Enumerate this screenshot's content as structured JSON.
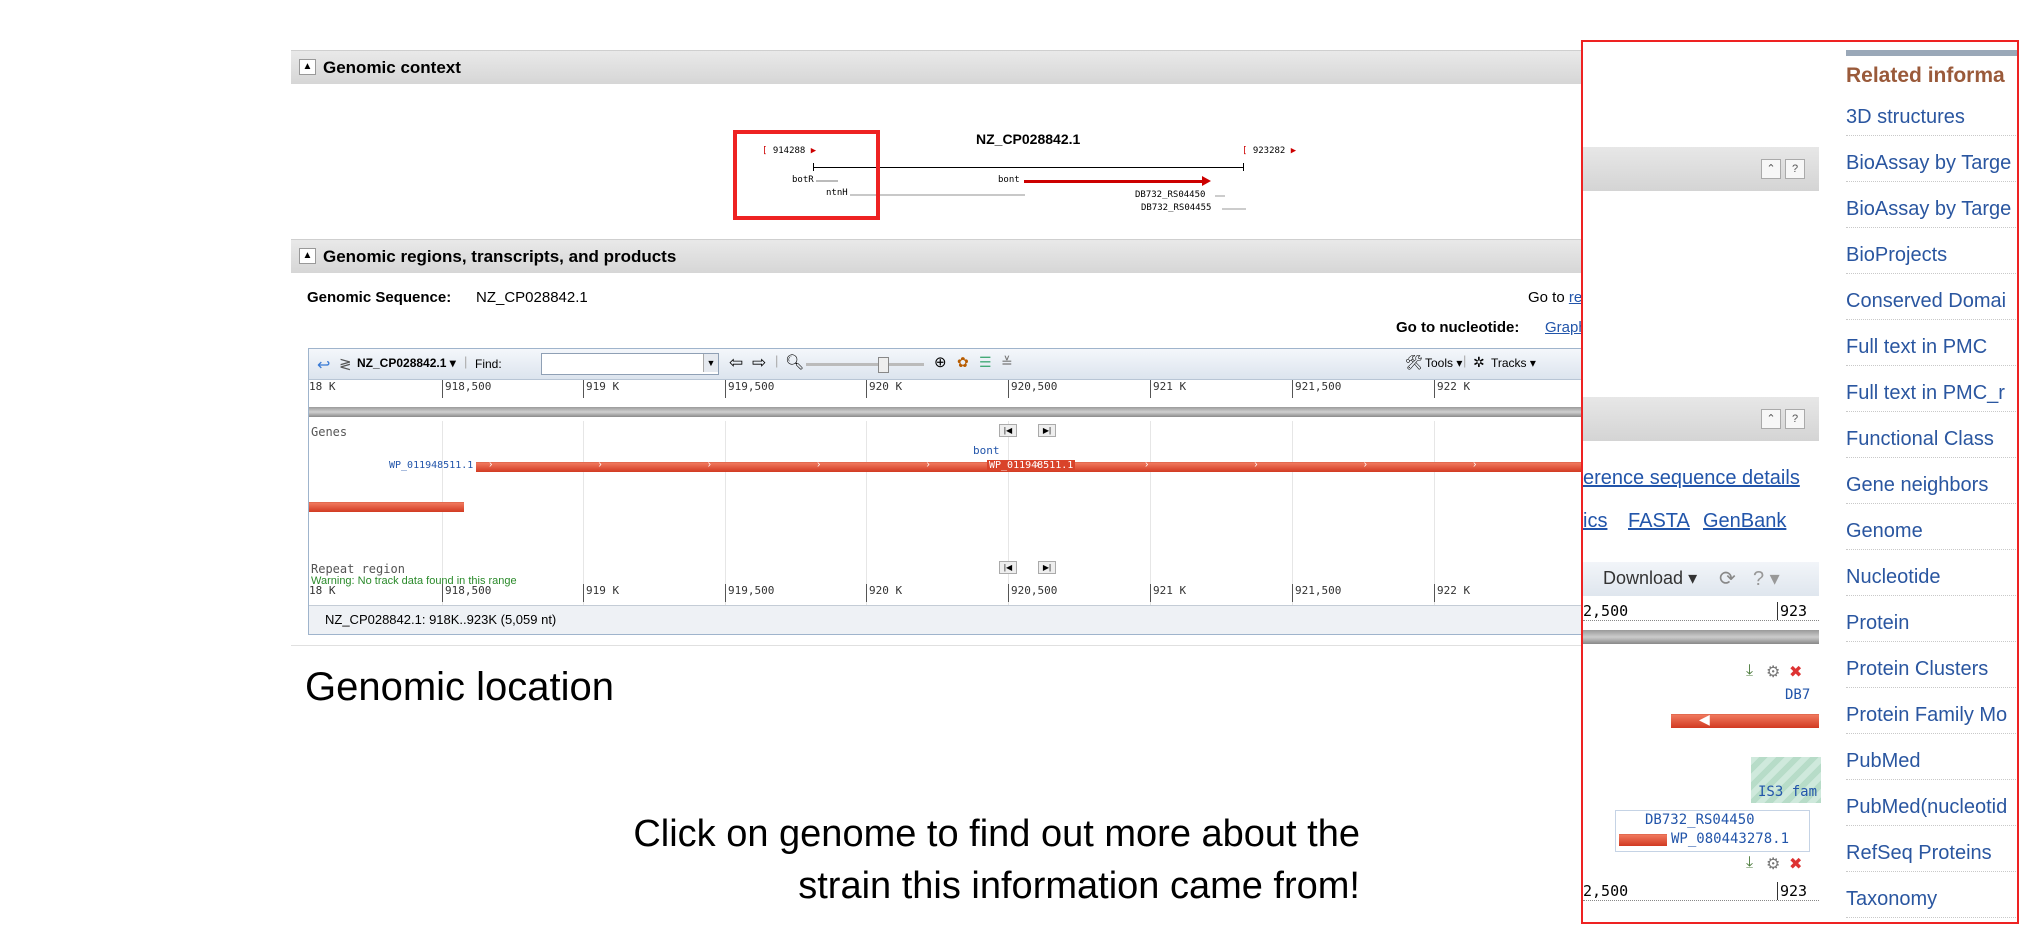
{
  "sections": {
    "genomic_context": "Genomic context",
    "genomic_regions": "Genomic regions, transcripts, and products"
  },
  "context": {
    "accession": "NZ_CP028842.1",
    "start": "914288",
    "end": "923282",
    "genes": [
      "botR",
      "ntnH",
      "bont",
      "DB732_RS04450",
      "DB732_RS04455"
    ]
  },
  "sequence": {
    "label": "Genomic Sequence:",
    "value": "NZ_CP028842.1",
    "goto_ref_prefix": "Go to ",
    "goto_ref_link": "re",
    "goto_nuc_label": "Go to nucleotide:",
    "goto_nuc_link": "Graph"
  },
  "viewer": {
    "accession": "NZ_CP028842.1",
    "find_label": "Find:",
    "tools": "Tools",
    "tracks": "Tracks",
    "ruler": [
      "18 K",
      "918,500",
      "919 K",
      "919,500",
      "920 K",
      "920,500",
      "921 K",
      "921,500",
      "922 K"
    ],
    "genes_track": "Genes",
    "gene_name": "bont",
    "protein_left": "WP_011948511.1",
    "protein_mid": "WP_011948511.1",
    "repeat_track": "Repeat region",
    "warning": "Warning: No track data found in this range",
    "status": "NZ_CP028842.1: 918K..923K (5,059 nt)"
  },
  "genomic_location": "Genomic location",
  "caption": {
    "line1": "Click on genome to find out more about the",
    "line2": "strain this information came from!"
  },
  "overlay": {
    "related_title": "Related informa",
    "related_items": [
      "3D structures",
      "BioAssay by Targe",
      "BioAssay by Targe",
      "BioProjects",
      "Conserved Domai",
      "Full text in PMC",
      "Full text in PMC_r",
      "Functional Class",
      "Gene neighbors",
      "Genome",
      "Nucleotide",
      "Protein",
      "Protein Clusters",
      "Protein Family Mo",
      "PubMed",
      "PubMed(nucleotid",
      "RefSeq Proteins",
      "Taxonomy"
    ],
    "ref_seq_details": "erence sequence details",
    "links": [
      "ics",
      "FASTA",
      "GenBank"
    ],
    "download": "Download",
    "ruler_left": "2,500",
    "ruler_right": "923",
    "db7": "DB7",
    "is3": "IS3 fam",
    "rs04450": "DB732_RS04450",
    "wp": "WP_080443278.1",
    "ruler2_left": "2,500",
    "ruler2_right": "923"
  },
  "colors": {
    "gene_red": "#d9432a",
    "link_blue": "#2255aa",
    "highlight_red": "#e22222"
  }
}
